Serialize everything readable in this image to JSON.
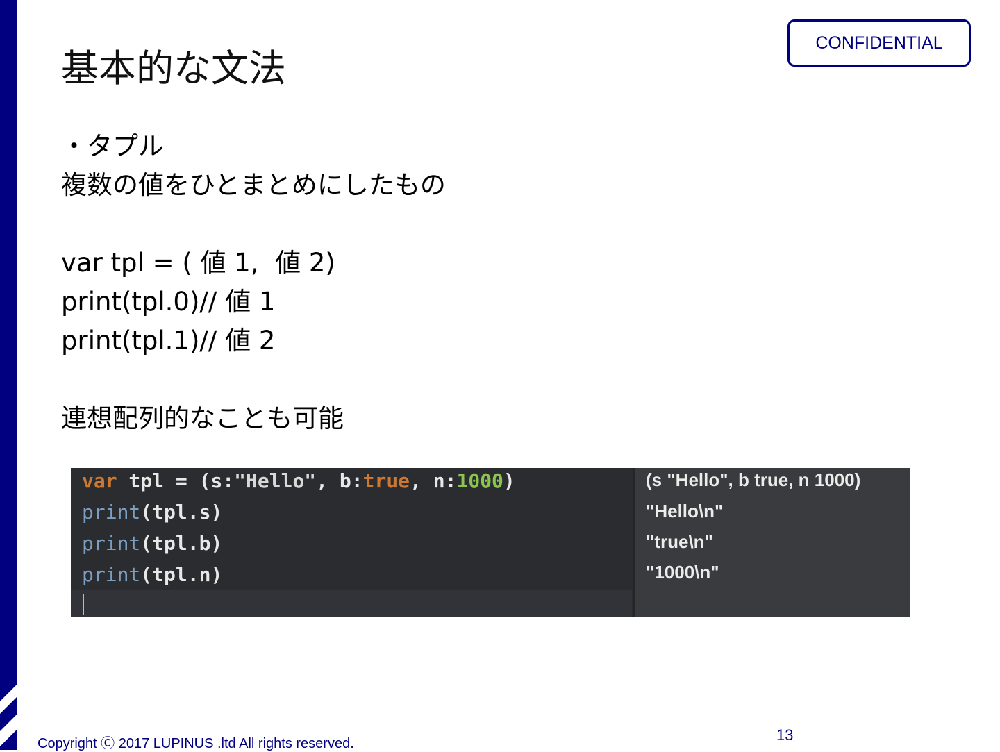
{
  "slide": {
    "title": "基本的な文法",
    "badge": "CONFIDENTIAL",
    "body_lines": [
      "・タプル",
      "複数の値をひとまとめにしたもの",
      "var tpl = ( 値 1,  値 2)",
      "print(tpl.0)// 値 1",
      "print(tpl.1)// 値 2",
      "連想配列的なことも可能"
    ],
    "footer": "Copyright Ⓒ 2017 LUPINUS .ltd All rights reserved.",
    "page_number": "13"
  },
  "playground": {
    "code_line_1": {
      "kw": "var",
      "t1": " tpl = (s:",
      "str": "\"Hello\"",
      "t2": ", b:",
      "bool": "true",
      "t3": ", n:",
      "num": "1000",
      "t4": ")"
    },
    "print_fn": "print",
    "print_args": [
      "(tpl.s)",
      "(tpl.b)",
      "(tpl.n)"
    ],
    "results": [
      "(s \"Hello\", b true, n 1000)",
      "\"Hello\\n\"",
      "\"true\\n\"",
      "\"1000\\n\""
    ],
    "colors": {
      "keyword": "#ca7832",
      "function": "#7b9fc0",
      "number": "#8cc450",
      "background": "#2b2c30"
    }
  }
}
